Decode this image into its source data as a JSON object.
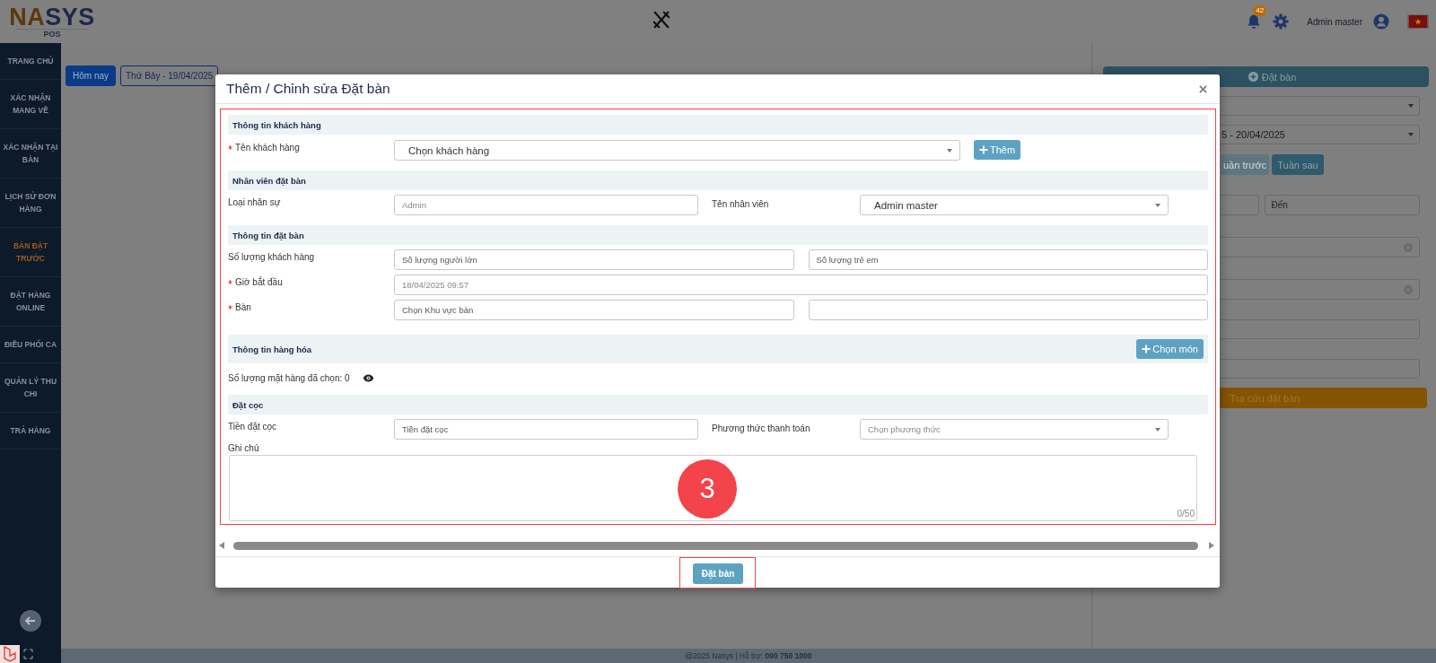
{
  "header": {
    "logo": {
      "parts": [
        "NA",
        "SYS"
      ],
      "sub": "POS"
    },
    "notifications": {
      "count": "42"
    },
    "user": {
      "name": "Admin master"
    }
  },
  "sidebar": {
    "items": [
      {
        "label": "TRANG CHỦ",
        "selected": false
      },
      {
        "label": "XÁC NHẬN MANG VỀ",
        "selected": false
      },
      {
        "label": "XÁC NHẬN TẠI BÀN",
        "selected": false
      },
      {
        "label": "LỊCH SỬ ĐƠN HÀNG",
        "selected": false
      },
      {
        "label": "BÀN ĐẶT TRƯỚC",
        "selected": true
      },
      {
        "label": "ĐẶT HÀNG ONLINE",
        "selected": false
      },
      {
        "label": "ĐIỀU PHỐI CA",
        "selected": false
      },
      {
        "label": "QUẢN LÝ THU CHI",
        "selected": false
      },
      {
        "label": "TRẢ HÀNG",
        "selected": false
      }
    ]
  },
  "toolbar": {
    "buttons": [
      {
        "label": "Hôm nay",
        "selected": true
      },
      {
        "label": "Thứ Bảy - 19/04/2025",
        "selected": false
      }
    ]
  },
  "booking_panel": {
    "add_button": "Đặt bàn",
    "week_select": "5 - 20/04/2025",
    "week_buttons": [
      {
        "label": "uần trước",
        "disabled": true
      },
      {
        "label": "Tuần sau",
        "disabled": false
      }
    ],
    "to_field": {
      "placeholder": "Đến"
    },
    "search_button": "Tra cứu đặt bàn"
  },
  "modal": {
    "title": "Thêm / Chỉnh sửa Đặt bàn",
    "sections": [
      {
        "title": "Thông tin khách hàng",
        "rows": [
          {
            "kind": "select-button",
            "label": "Tên khách hàng",
            "required": true,
            "fields": [
              {
                "kind": "select",
                "value": "Chọn khách hàng"
              }
            ],
            "button": "Thêm"
          }
        ]
      },
      {
        "title": "Nhân viên đặt bàn",
        "rows": [
          {
            "kind": "split",
            "label": "Loại nhân sự",
            "required": false,
            "fields": [
              {
                "kind": "input",
                "value": "Admin",
                "disabled": true
              },
              {
                "kind": "select",
                "label": "Tên nhân viên",
                "value": "Admin master"
              }
            ]
          }
        ]
      },
      {
        "title": "Thông tin đặt bàn",
        "rows": [
          {
            "kind": "pair",
            "label": "Số lượng khách hàng",
            "required": false,
            "fields": [
              {
                "kind": "input",
                "placeholder": "Số lượng người lớn"
              },
              {
                "kind": "input",
                "placeholder": "Số lượng trẻ em"
              }
            ]
          },
          {
            "kind": "full",
            "label": "Giờ bắt đầu",
            "required": true,
            "fields": [
              {
                "kind": "input",
                "value": "18/04/2025 09:57",
                "disabled": true
              }
            ]
          },
          {
            "kind": "pair",
            "label": "Bàn",
            "required": true,
            "fields": [
              {
                "kind": "input",
                "placeholder": "Chọn Khu vực bàn"
              },
              {
                "kind": "input"
              }
            ]
          }
        ]
      },
      {
        "title": "Thông tin hàng hóa",
        "action": "Chọn món",
        "rows": [
          {
            "kind": "info",
            "label": "Số lượng mặt hàng đã chọn: 0"
          }
        ]
      },
      {
        "title": "Đặt cọc",
        "rows": [
          {
            "kind": "split",
            "label": "Tiền đặt cọc",
            "required": false,
            "fields": [
              {
                "kind": "input",
                "placeholder": "Tiền đặt cọc"
              },
              {
                "kind": "select",
                "label": "Phương thức thanh toán",
                "placeholder": "Chọn phương thức"
              }
            ]
          },
          {
            "kind": "textarea",
            "label": "Ghi chú",
            "counter": "0/50"
          }
        ]
      }
    ],
    "step_marker": "3",
    "submit_button": "Đặt bàn"
  },
  "footer": {
    "text": "@2025 Nasys | Hỗ trợ: **090 750 1000**"
  }
}
